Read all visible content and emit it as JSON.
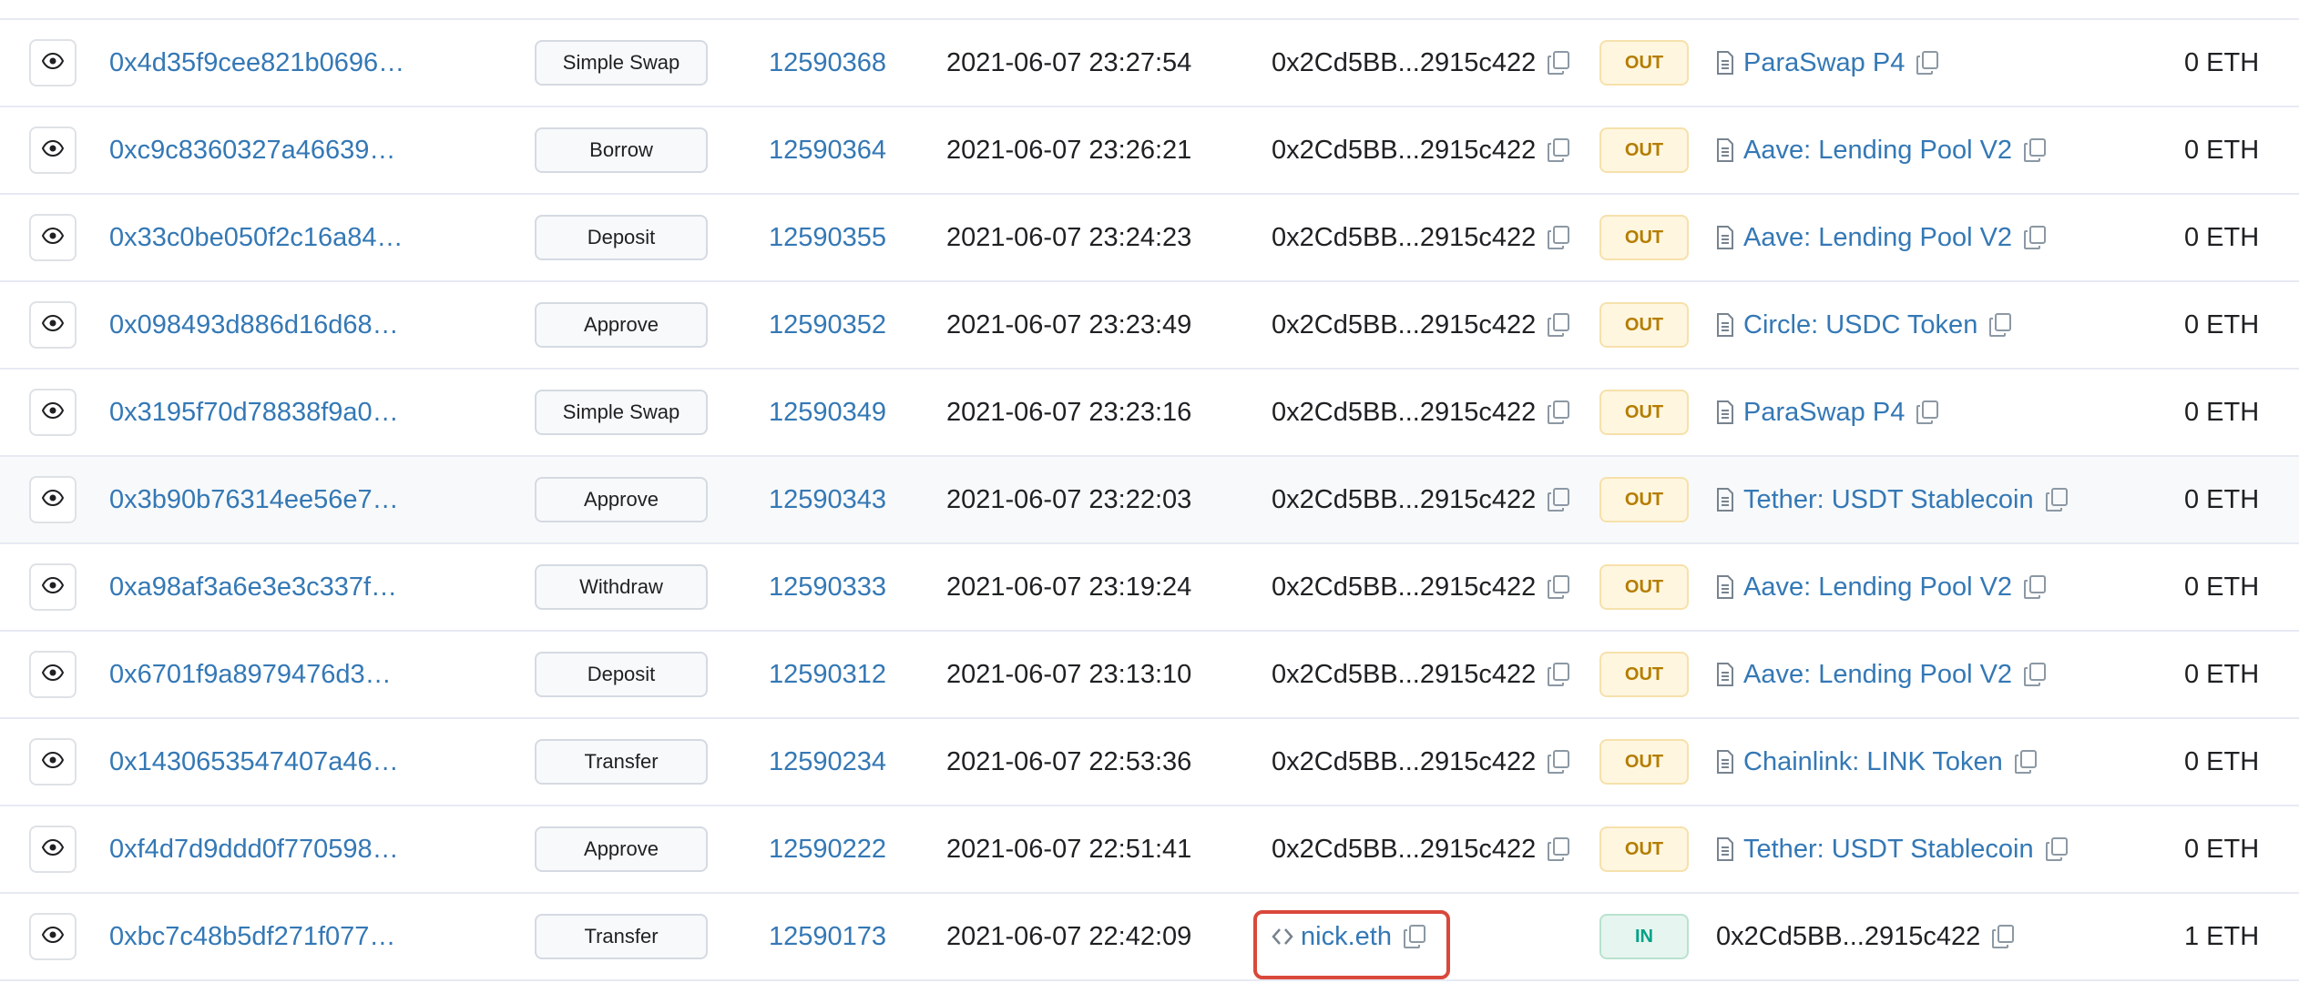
{
  "transactions": [
    {
      "hash": "0x4d35f9cee821b0696…",
      "method": "Simple Swap",
      "block": "12590368",
      "age": "2021-06-07 23:27:54",
      "from": "0x2Cd5BB...2915c422",
      "from_type": "address",
      "direction": "OUT",
      "to": "ParaSwap P4",
      "to_type": "contract",
      "value": "0 ETH"
    },
    {
      "hash": "0xc9c8360327a46639…",
      "method": "Borrow",
      "block": "12590364",
      "age": "2021-06-07 23:26:21",
      "from": "0x2Cd5BB...2915c422",
      "from_type": "address",
      "direction": "OUT",
      "to": "Aave: Lending Pool V2",
      "to_type": "contract",
      "value": "0 ETH"
    },
    {
      "hash": "0x33c0be050f2c16a84…",
      "method": "Deposit",
      "block": "12590355",
      "age": "2021-06-07 23:24:23",
      "from": "0x2Cd5BB...2915c422",
      "from_type": "address",
      "direction": "OUT",
      "to": "Aave: Lending Pool V2",
      "to_type": "contract",
      "value": "0 ETH"
    },
    {
      "hash": "0x098493d886d16d68…",
      "method": "Approve",
      "block": "12590352",
      "age": "2021-06-07 23:23:49",
      "from": "0x2Cd5BB...2915c422",
      "from_type": "address",
      "direction": "OUT",
      "to": "Circle: USDC Token",
      "to_type": "contract",
      "value": "0 ETH"
    },
    {
      "hash": "0x3195f70d78838f9a0…",
      "method": "Simple Swap",
      "block": "12590349",
      "age": "2021-06-07 23:23:16",
      "from": "0x2Cd5BB...2915c422",
      "from_type": "address",
      "direction": "OUT",
      "to": "ParaSwap P4",
      "to_type": "contract",
      "value": "0 ETH"
    },
    {
      "hash": "0x3b90b76314ee56e7…",
      "method": "Approve",
      "block": "12590343",
      "age": "2021-06-07 23:22:03",
      "from": "0x2Cd5BB...2915c422",
      "from_type": "address",
      "direction": "OUT",
      "to": "Tether: USDT Stablecoin",
      "to_type": "contract",
      "value": "0 ETH",
      "hovered": true
    },
    {
      "hash": "0xa98af3a6e3e3c337f…",
      "method": "Withdraw",
      "block": "12590333",
      "age": "2021-06-07 23:19:24",
      "from": "0x2Cd5BB...2915c422",
      "from_type": "address",
      "direction": "OUT",
      "to": "Aave: Lending Pool V2",
      "to_type": "contract",
      "value": "0 ETH"
    },
    {
      "hash": "0x6701f9a8979476d3…",
      "method": "Deposit",
      "block": "12590312",
      "age": "2021-06-07 23:13:10",
      "from": "0x2Cd5BB...2915c422",
      "from_type": "address",
      "direction": "OUT",
      "to": "Aave: Lending Pool V2",
      "to_type": "contract",
      "value": "0 ETH"
    },
    {
      "hash": "0x1430653547407a46…",
      "method": "Transfer",
      "block": "12590234",
      "age": "2021-06-07 22:53:36",
      "from": "0x2Cd5BB...2915c422",
      "from_type": "address",
      "direction": "OUT",
      "to": "Chainlink: LINK Token",
      "to_type": "contract",
      "value": "0 ETH"
    },
    {
      "hash": "0xf4d7d9ddd0f770598…",
      "method": "Approve",
      "block": "12590222",
      "age": "2021-06-07 22:51:41",
      "from": "0x2Cd5BB...2915c422",
      "from_type": "address",
      "direction": "OUT",
      "to": "Tether: USDT Stablecoin",
      "to_type": "contract",
      "value": "0 ETH"
    },
    {
      "hash": "0xbc7c48b5df271f077…",
      "method": "Transfer",
      "block": "12590173",
      "age": "2021-06-07 22:42:09",
      "from": "nick.eth",
      "from_type": "ens",
      "direction": "IN",
      "to": "0x2Cd5BB...2915c422",
      "to_type": "address",
      "value": "1 ETH",
      "highlighted_from": true
    }
  ],
  "colors": {
    "link": "#3478b5",
    "out_badge_bg": "#fff6e0",
    "out_badge_text": "#b47d00",
    "in_badge_bg": "#e6f5ef",
    "in_badge_text": "#00a186",
    "highlight_box": "#d9483b"
  },
  "icons": {
    "view": "eye-icon",
    "copy": "copy-icon",
    "contract": "document-icon",
    "ens": "code-icon"
  }
}
